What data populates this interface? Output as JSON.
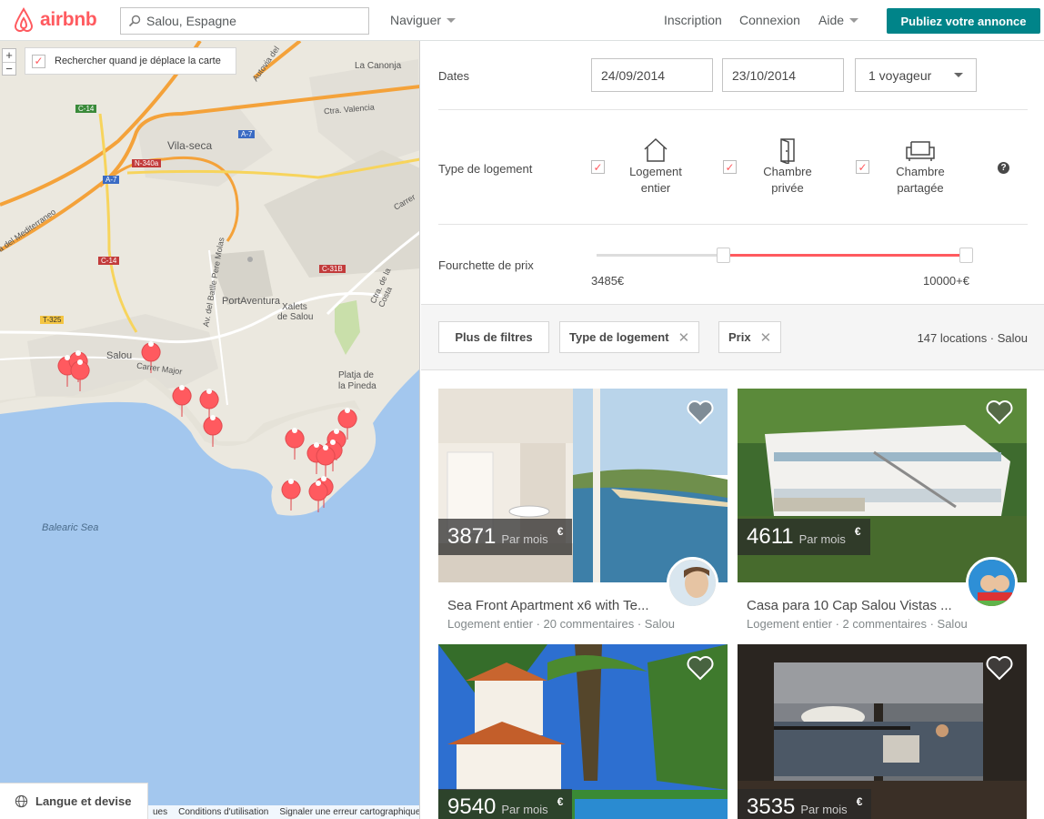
{
  "header": {
    "logo_text": "airbnb",
    "search_value": "Salou, Espagne",
    "browse_label": "Naviguer",
    "signup_label": "Inscription",
    "login_label": "Connexion",
    "help_label": "Aide",
    "host_button": "Publiez votre annonce",
    "brand_color": "#ff5a5f",
    "host_color": "#008489"
  },
  "map": {
    "zoom_in": "+",
    "zoom_out": "−",
    "search_as_move_label": "Rechercher quand je déplace la carte",
    "search_as_move_checked": true,
    "labels": {
      "vila_seca": "Vila-seca",
      "la_canonja": "La Canonja",
      "portaventura": "PortAventura",
      "salou": "Salou",
      "xalets": "Xalets",
      "de_salou": "de Salou",
      "platja": "Platja de",
      "la_pineda": "la Pineda",
      "balearic": "Balearic Sea",
      "carrer_major": "Carrer Major",
      "ctra_valencia": "Ctra. Valencia",
      "autovia": "Autovia del",
      "mediterraneo": "via del Mediterraneo",
      "bartle": "Av. del Batlle Pere Molas",
      "ctra_costa": "Ctra. de la Costa",
      "carrer": "Carrer"
    },
    "road_badges": {
      "c14a": "C-14",
      "a7a": "A-7",
      "a7b": "A-7",
      "n340": "N-340a",
      "c14b": "C-14",
      "c31b": "C-31B",
      "t325": "T-325"
    },
    "footer_links": [
      "ues",
      "Conditions d'utilisation",
      "Signaler une erreur cartographique"
    ],
    "language_button": "Langue et devise"
  },
  "filters": {
    "dates_label": "Dates",
    "checkin": "24/09/2014",
    "checkout": "23/10/2014",
    "guests": "1 voyageur",
    "room_type_label": "Type de logement",
    "room_types": [
      {
        "line1": "Logement",
        "line2": "entier",
        "checked": true
      },
      {
        "line1": "Chambre",
        "line2": "privée",
        "checked": true
      },
      {
        "line1": "Chambre",
        "line2": "partagée",
        "checked": true
      }
    ],
    "help_icon": "?",
    "price_label": "Fourchette de prix",
    "price_min": "3485€",
    "price_max": "10000+€"
  },
  "filter_bar": {
    "more_filters": "Plus de filtres",
    "chip_room_type": "Type de logement",
    "chip_price": "Prix",
    "result_count": "147 locations · Salou"
  },
  "listings": [
    {
      "price": "3871",
      "per": "Par mois",
      "currency": "€",
      "title": "Sea Front Apartment x6 with Te...",
      "meta": "Logement entier · 20 commentaires · Salou"
    },
    {
      "price": "4611",
      "per": "Par mois",
      "currency": "€",
      "title": "Casa para 10 Cap Salou Vistas ...",
      "meta": "Logement entier · 2 commentaires · Salou"
    },
    {
      "price": "9540",
      "per": "Par mois",
      "currency": "€",
      "title": "",
      "meta": ""
    },
    {
      "price": "3535",
      "per": "Par mois",
      "currency": "€",
      "title": "",
      "meta": ""
    }
  ]
}
